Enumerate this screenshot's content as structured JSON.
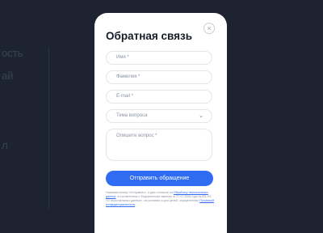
{
  "background": {
    "fragments": [
      "ость",
      "ай",
      "л"
    ]
  },
  "modal": {
    "title": "Обратная связь",
    "close_symbol": "×",
    "fields": {
      "first_name": "Имя *",
      "last_name": "Фамилия *",
      "email": "E-mail *",
      "topic": "Тема вопроса",
      "question": "Опишите вопрос *"
    },
    "topic_chevron": "⌄",
    "submit_label": "Отправить обращение",
    "consent": {
      "part1": "Нажимая кнопку «Отправить», я даю согласие на",
      "link1": "Обработку персональных данных",
      "part2": ", в соответствии с Федеральным законом от 27.07.2006 года №152-ФЗ «О персональных данных», на условиях и для целей, определенных",
      "link2": "Политикой конфиденциальности"
    }
  },
  "colors": {
    "accent": "#2f6cf2",
    "backdrop": "#1d2331"
  }
}
